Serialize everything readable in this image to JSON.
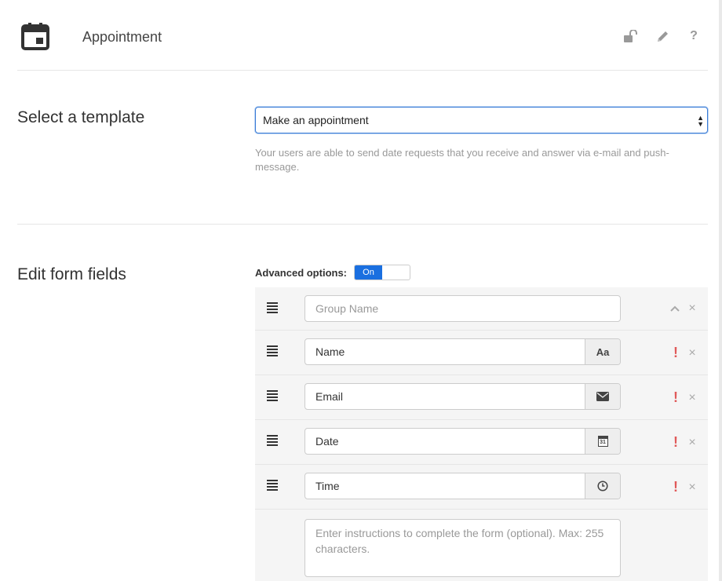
{
  "header": {
    "title": "Appointment",
    "icons": [
      "calendar-icon",
      "unlock-icon",
      "pencil-icon",
      "help-icon"
    ],
    "help_label": "?"
  },
  "template_section": {
    "title": "Select a template",
    "select_value": "Make an appointment",
    "hint": "Your users are able to send date requests that you receive and answer via e-mail and push-message."
  },
  "form_section": {
    "title": "Edit form fields",
    "advanced_label": "Advanced options:",
    "advanced_toggle": "On",
    "group_name_placeholder": "Group Name",
    "fields": [
      {
        "value": "Name",
        "addon": "Aa",
        "addon_icon": "text-icon"
      },
      {
        "value": "Email",
        "addon_icon": "envelope-icon"
      },
      {
        "value": "Date",
        "addon_icon": "calendar-31-icon",
        "addon_text": "31"
      },
      {
        "value": "Time",
        "addon_icon": "clock-icon"
      }
    ],
    "required_mark": "!",
    "remove_mark": "×",
    "instructions_placeholder": "Enter instructions to complete the form (optional). Max: 255 characters."
  },
  "colors": {
    "accent": "#1a6fe0",
    "required": "#e05a5a",
    "row_bg": "#f5f5f5"
  }
}
